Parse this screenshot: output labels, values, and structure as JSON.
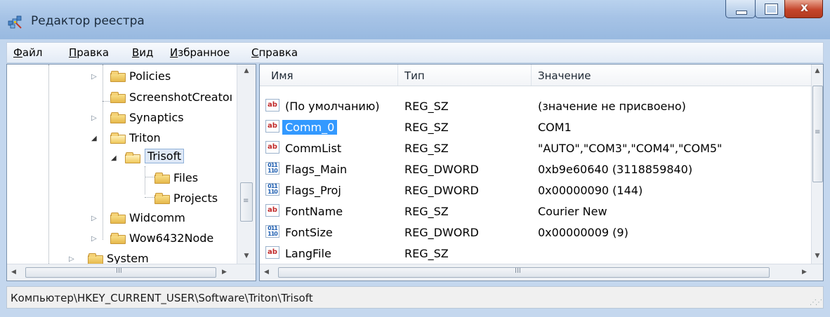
{
  "window": {
    "title": "Редактор реестра",
    "close_glyph": "x"
  },
  "menu": [
    {
      "label": "Файл",
      "access": "Ф",
      "rest": "айл"
    },
    {
      "label": "Правка",
      "access": "П",
      "rest": "равка"
    },
    {
      "label": "Вид",
      "access": "В",
      "rest": "ид"
    },
    {
      "label": "Избранное",
      "access": "И",
      "rest": "збранное"
    },
    {
      "label": "Справка",
      "access": "С",
      "rest": "правка"
    }
  ],
  "tree": {
    "nodes": [
      {
        "label": "Policies",
        "expander": "collapsed"
      },
      {
        "label": "ScreenshotCreator",
        "display": "ScreenshotCreatoı",
        "expander": "none"
      },
      {
        "label": "Synaptics",
        "expander": "collapsed"
      },
      {
        "label": "Triton",
        "expander": "expanded"
      },
      {
        "label": "Trisoft",
        "expander": "expanded",
        "selected": true
      },
      {
        "label": "Files",
        "expander": "none"
      },
      {
        "label": "Projects",
        "expander": "none"
      },
      {
        "label": "Widcomm",
        "expander": "collapsed"
      },
      {
        "label": "Wow6432Node",
        "expander": "collapsed"
      },
      {
        "label": "System",
        "expander": "collapsed"
      }
    ]
  },
  "list": {
    "columns": [
      "Имя",
      "Тип",
      "Значение"
    ],
    "rows": [
      {
        "icon": "reg-sz-icon",
        "name": "(По умолчанию)",
        "type": "REG_SZ",
        "value": "(значение не присвоено)"
      },
      {
        "icon": "reg-sz-icon",
        "name": "Comm_0",
        "type": "REG_SZ",
        "value": "COM1",
        "selected": true
      },
      {
        "icon": "reg-sz-icon",
        "name": "CommList",
        "type": "REG_SZ",
        "value": "\"AUTO\",\"COM3\",\"COM4\",\"COM5\""
      },
      {
        "icon": "reg-dword-icon",
        "name": "Flags_Main",
        "type": "REG_DWORD",
        "value": "0xb9e60640 (3118859840)"
      },
      {
        "icon": "reg-dword-icon",
        "name": "Flags_Proj",
        "type": "REG_DWORD",
        "value": "0x00000090 (144)"
      },
      {
        "icon": "reg-sz-icon",
        "name": "FontName",
        "type": "REG_SZ",
        "value": "Courier New"
      },
      {
        "icon": "reg-dword-icon",
        "name": "FontSize",
        "type": "REG_DWORD",
        "value": "0x00000009 (9)"
      },
      {
        "icon": "reg-sz-icon",
        "name": "LangFile",
        "type": "REG_SZ",
        "value": ""
      }
    ],
    "icon_glyphs": {
      "sz": "ab",
      "dword": "011\n110"
    }
  },
  "scroll_grip": "III",
  "status": {
    "path": "Компьютер\\HKEY_CURRENT_USER\\Software\\Triton\\Trisoft"
  },
  "colors": {
    "selection": "#3399ff",
    "title_bar": "#a6c3e6",
    "close_button": "#c5462c"
  }
}
